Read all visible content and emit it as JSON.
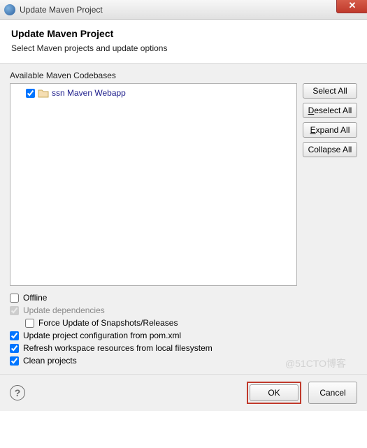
{
  "titlebar": {
    "title": "Update Maven Project"
  },
  "header": {
    "title": "Update Maven Project",
    "subtitle": "Select Maven projects and update options"
  },
  "section": {
    "available_label": "Available Maven Codebases"
  },
  "tree": {
    "items": [
      {
        "label": "ssn Maven Webapp",
        "checked": true
      }
    ]
  },
  "side_buttons": {
    "select_all": "Select All",
    "deselect_all": "Deselect All",
    "expand_all": "Expand All",
    "collapse_all": "Collapse All"
  },
  "options": {
    "offline": {
      "label": "Offline",
      "checked": false,
      "enabled": true
    },
    "update_deps": {
      "label": "Update dependencies",
      "checked": true,
      "enabled": false
    },
    "force_update": {
      "label": "Force Update of Snapshots/Releases",
      "checked": false,
      "enabled": true
    },
    "update_config": {
      "label": "Update project configuration from pom.xml",
      "checked": true,
      "enabled": true
    },
    "refresh_ws": {
      "label": "Refresh workspace resources from local filesystem",
      "checked": true,
      "enabled": true
    },
    "clean": {
      "label": "Clean projects",
      "checked": true,
      "enabled": true
    }
  },
  "buttons": {
    "ok": "OK",
    "cancel": "Cancel"
  },
  "watermark": "@51CTO博客"
}
